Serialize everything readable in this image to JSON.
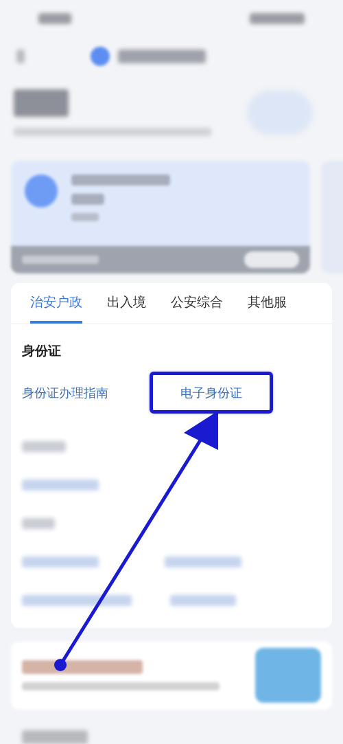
{
  "tabs": [
    {
      "label": "治安户政",
      "selected": true
    },
    {
      "label": "出入境",
      "selected": false
    },
    {
      "label": "公安综合",
      "selected": false
    },
    {
      "label": "其他服",
      "selected": false
    }
  ],
  "section": {
    "title": "身份证",
    "links": [
      {
        "label": "身份证办理指南",
        "highlighted": false
      },
      {
        "label": "电子身份证",
        "highlighted": true
      }
    ]
  }
}
